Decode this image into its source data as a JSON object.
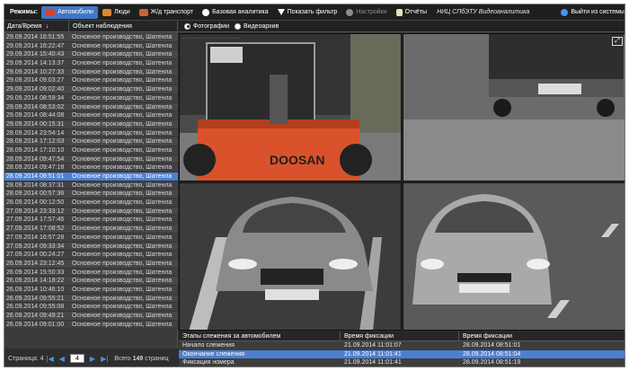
{
  "menu": {
    "modes_label": "Режимы:",
    "items": [
      {
        "label": "Автомобили",
        "icon": "car-icon",
        "active": true
      },
      {
        "label": "Люди",
        "icon": "people-icon"
      },
      {
        "label": "Ж/д транспорт",
        "icon": "train-icon"
      },
      {
        "label": "Базовая аналитика",
        "icon": "target-icon"
      },
      {
        "label": "Показать фильтр",
        "icon": "filter-icon"
      },
      {
        "label": "Настройки",
        "icon": "gear-icon"
      },
      {
        "label": "Отчёты",
        "icon": "report-icon"
      }
    ],
    "org": "НИЦ СПбЭТУ Видеоаналитика",
    "exit_label": "Выйти из системы"
  },
  "list": {
    "col_date": "Дата/Время",
    "col_object": "Объект наблюдения",
    "rows": [
      {
        "date": "29.09.2014 16:51:55",
        "object": "Основное производство, Шатенла"
      },
      {
        "date": "29.09.2014 16:22:47",
        "object": "Основное производство, Шатенла"
      },
      {
        "date": "29.09.2014 15:40:43",
        "object": "Основное производство, Шатенла"
      },
      {
        "date": "29.09.2014 14:13:37",
        "object": "Основное производство, Шатенла"
      },
      {
        "date": "29.09.2014 10:27:33",
        "object": "Основное производство, Шатенла"
      },
      {
        "date": "29.09.2014 09:03:27",
        "object": "Основное производство, Шатенла"
      },
      {
        "date": "29.09.2014 09:02:40",
        "object": "Основное производство, Шатенла"
      },
      {
        "date": "29.09.2014 08:59:34",
        "object": "Основное производство, Шатенла"
      },
      {
        "date": "29.09.2014 08:53:02",
        "object": "Основное производство, Шатенла"
      },
      {
        "date": "29.09.2014 08:44:08",
        "object": "Основное производство, Шатенла"
      },
      {
        "date": "29.09.2014 00:15:31",
        "object": "Основное производство, Шатенла"
      },
      {
        "date": "28.09.2014 23:54:14",
        "object": "Основное производство, Шатенла"
      },
      {
        "date": "28.09.2014 17:12:03",
        "object": "Основное производство, Шатенла"
      },
      {
        "date": "28.09.2014 17:10:10",
        "object": "Основное производство, Шатенла"
      },
      {
        "date": "28.09.2014 09:47:54",
        "object": "Основное производство, Шатенла"
      },
      {
        "date": "28.09.2014 09:47:18",
        "object": "Основное производство, Шатенла"
      },
      {
        "date": "28.09.2014 08:51:01",
        "object": "Основное производство, Шатенла",
        "selected": true
      },
      {
        "date": "28.09.2014 08:37:31",
        "object": "Основное производство, Шатенла"
      },
      {
        "date": "28.09.2014 00:57:36",
        "object": "Основное производство, Шатенла"
      },
      {
        "date": "28.09.2014 00:12:50",
        "object": "Основное производство, Шатенла"
      },
      {
        "date": "27.09.2014 23:33:12",
        "object": "Основное производство, Шатенла"
      },
      {
        "date": "27.09.2014 17:57:46",
        "object": "Основное производство, Шатенла"
      },
      {
        "date": "27.09.2014 17:08:52",
        "object": "Основное производство, Шатенла"
      },
      {
        "date": "27.09.2014 16:57:28",
        "object": "Основное производство, Шатенла"
      },
      {
        "date": "27.09.2014 09:33:34",
        "object": "Основное производство, Шатенла"
      },
      {
        "date": "27.09.2014 00:24:27",
        "object": "Основное производство, Шатенла"
      },
      {
        "date": "26.09.2014 23:12:45",
        "object": "Основное производство, Шатенла"
      },
      {
        "date": "26.09.2014 15:50:33",
        "object": "Основное производство, Шатенла"
      },
      {
        "date": "26.09.2014 14:18:22",
        "object": "Основное производство, Шатенла"
      },
      {
        "date": "26.09.2014 10:46:10",
        "object": "Основное производство, Шатенла"
      },
      {
        "date": "26.09.2014 09:55:21",
        "object": "Основное производство, Шатенла"
      },
      {
        "date": "26.09.2014 09:55:08",
        "object": "Основное производство, Шатенла"
      },
      {
        "date": "26.09.2014 09:49:21",
        "object": "Основное производство, Шатенла"
      },
      {
        "date": "26.09.2014 09:01:00",
        "object": "Основное производство, Шатенла"
      }
    ],
    "pager": {
      "pages_label": "Страница: 4",
      "current": "4",
      "total_label": "Всего",
      "total_count": "149",
      "total_suffix": "страниц"
    }
  },
  "viewer": {
    "tab_photos": "Фотографии",
    "tab_video": "Видеоархив",
    "photo1_plate_text": "DOOSAN",
    "photo_caption": "........  ..........  .......  ........  ...........  .........",
    "expand_icon": "expand-icon"
  },
  "events": {
    "col_stage": "Этапы слежения за автомобилем",
    "col_time1": "Время фиксации",
    "col_time2": "Время фиксации",
    "rows": [
      {
        "stage": "Начало слежения",
        "t1": "21.09.2014 11:01:07",
        "t2": "28.09.2014 08:51:01"
      },
      {
        "stage": "Окончание слежения",
        "t1": "21.09.2014 11:01:41",
        "t2": "28.09.2014 08:51:04",
        "selected": true
      },
      {
        "stage": "Фиксация номера",
        "t1": "21.09.2014 11:01:41",
        "t2": "28.09.2014 08:51:19"
      }
    ]
  },
  "colors": {
    "accent": "#3f77c9",
    "selection": "#4d7fd0",
    "panel": "#3a3a3a",
    "forklift": "#d9522b"
  }
}
